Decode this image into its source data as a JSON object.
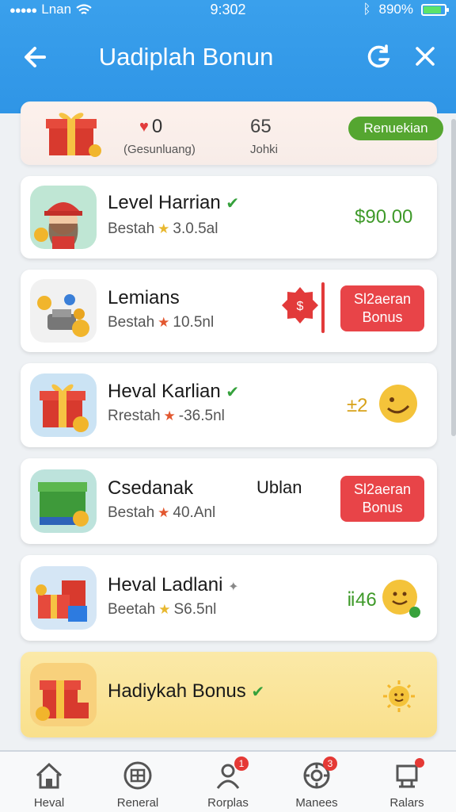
{
  "status_bar": {
    "carrier": "Lnan",
    "time": "9:302",
    "battery": "890%"
  },
  "header": {
    "title": "Uadiplah Bonun"
  },
  "summary": {
    "points": "0",
    "points_label": "(Gesunluang)",
    "count": "65",
    "count_label": "Johki",
    "button": "Renuekian"
  },
  "items": [
    {
      "name": "Level Harrian",
      "meta_label": "Bestah",
      "meta_value": "3.0.5al",
      "reward": "$90.00"
    },
    {
      "name": "Lemians",
      "meta_label": "Bestah",
      "meta_value": "10.5nl",
      "button": "Sl2aeran Bonus"
    },
    {
      "name": "Heval Karlian",
      "meta_label": "Rrestah",
      "meta_value": "-36.5nl",
      "reward": "±2"
    },
    {
      "name": "Csedanak",
      "name_extra": "Ublan",
      "meta_label": "Bestah",
      "meta_value": "40.Anl",
      "button": "Sl2aeran Bonus"
    },
    {
      "name": "Heval Ladlani",
      "meta_label": "Beetah",
      "meta_value": "S6.5nl",
      "reward": "ⅱ46"
    },
    {
      "name": "Hadiykah Bonus"
    }
  ],
  "nav": [
    {
      "label": "Heval",
      "icon": "home-icon"
    },
    {
      "label": "Reneral",
      "icon": "grid-icon"
    },
    {
      "label": "Rorplas",
      "icon": "profile-icon",
      "badge": "1"
    },
    {
      "label": "Manees",
      "icon": "gear-icon",
      "badge": "3"
    },
    {
      "label": "Ralars",
      "icon": "cart-icon",
      "badge": ""
    }
  ],
  "colors": {
    "header": "#3aa0ec",
    "accent_green": "#55a630",
    "accent_red": "#e84448"
  }
}
